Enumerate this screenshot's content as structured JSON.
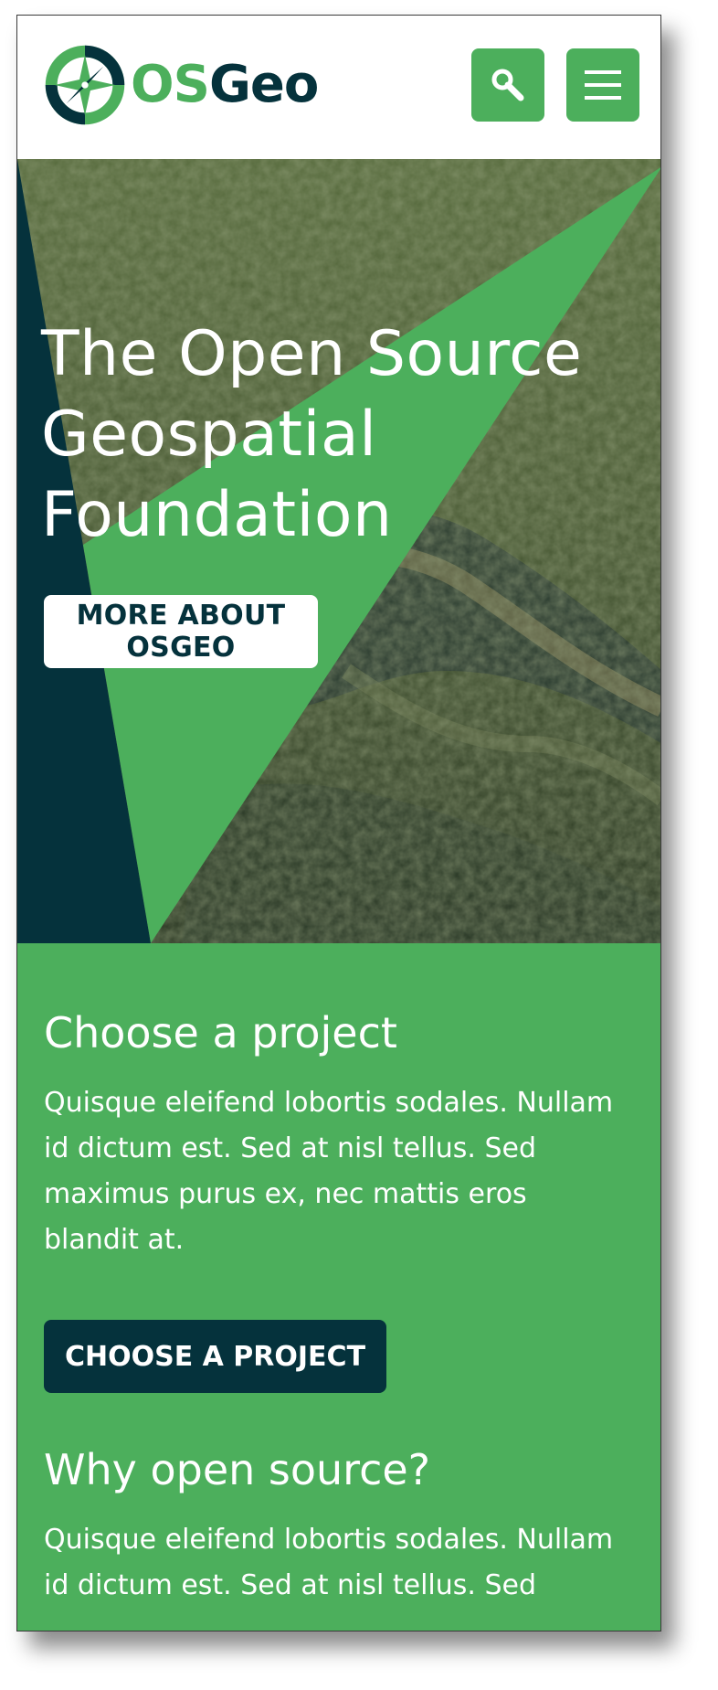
{
  "header": {
    "logo_os": "OS",
    "logo_geo": "Geo",
    "search_icon": "search-icon",
    "menu_icon": "hamburger-menu-icon"
  },
  "hero": {
    "title": "The Open Source Geospatial Foundation",
    "button_label": "MORE ABOUT OSGEO"
  },
  "sections": [
    {
      "title": "Choose a project",
      "text": "Quisque eleifend lobortis sodales. Nullam id dictum est. Sed at nisl tellus. Sed maximus purus ex, nec mattis eros blandit at.",
      "button_label": "CHOOSE A PROJECT"
    },
    {
      "title": "Why open source?",
      "text": "Quisque eleifend lobortis sodales. Nullam id dictum est. Sed at nisl tellus. Sed"
    }
  ],
  "colors": {
    "brand_green": "#4caf5c",
    "brand_dark": "#05323c",
    "white": "#ffffff"
  }
}
